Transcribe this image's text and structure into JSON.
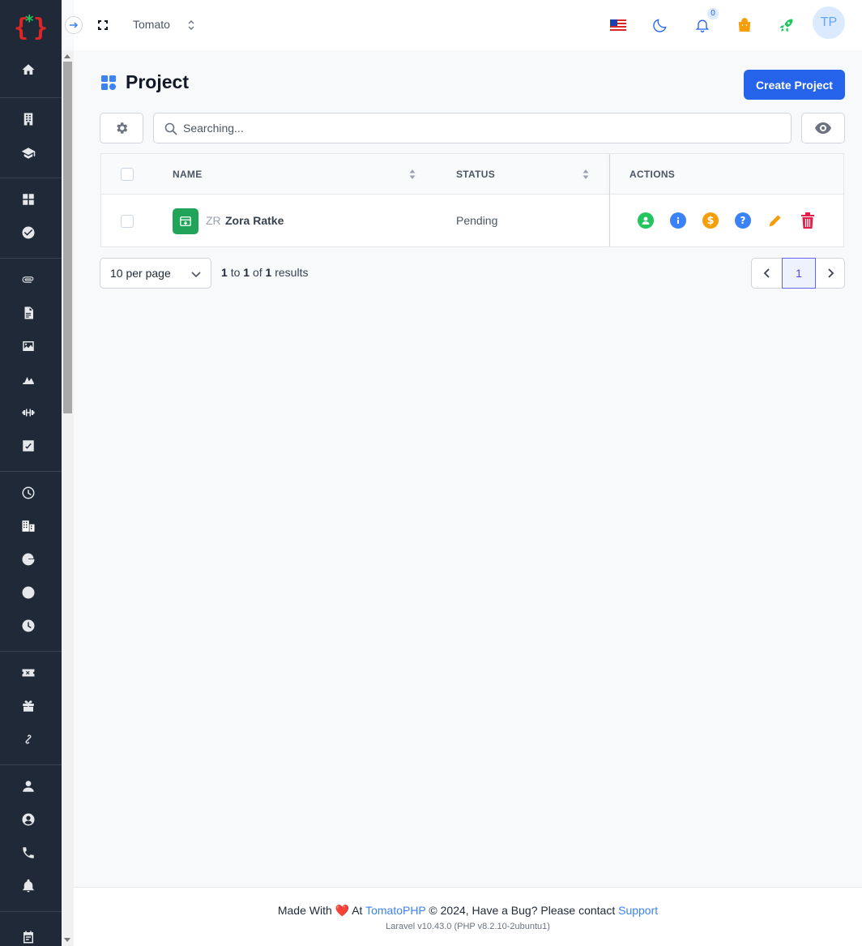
{
  "header": {
    "tenant": "Tomato",
    "notifications_count": "0",
    "avatar_initials": "TP"
  },
  "page": {
    "title": "Project",
    "create_button": "Create Project"
  },
  "search": {
    "placeholder": "Searching..."
  },
  "table": {
    "columns": [
      "NAME",
      "STATUS",
      "ACTIONS"
    ],
    "rows": [
      {
        "initials": "ZR",
        "name": "Zora Ratke",
        "status": "Pending"
      }
    ]
  },
  "pagination": {
    "per_page": "10 per page",
    "from": "1",
    "to": "1",
    "total": "1",
    "to_label": "to",
    "of_label": "of",
    "results_label": "results",
    "current_page": "1"
  },
  "footer": {
    "made_with": "Made With",
    "heart": "❤️",
    "at": "At",
    "brand": "TomatoPHP",
    "copyright": "© 2024, Have a Bug? Please contact",
    "support": "Support",
    "version": "Laravel v10.43.0 (PHP v8.2.10-2ubuntu1)"
  },
  "colors": {
    "primary": "#2563eb",
    "sidebar": "#1f2937",
    "brand_red": "#dc2626",
    "brand_green": "#22c55e",
    "status_pending_badge": "#22a35a",
    "delete": "#e11d48",
    "edit": "#f59e0b"
  },
  "icons": {
    "sidebar": [
      "home-icon",
      "building-icon",
      "school-icon",
      "grid-icon",
      "check-circle-icon",
      "paperclip-icon",
      "document-icon",
      "image-icon",
      "chart-area-icon",
      "dumbbell-icon",
      "chart-check-icon",
      "clock-icon",
      "buildings-icon",
      "pie-chart-icon",
      "bolt-icon",
      "clock-filled-icon",
      "ticket-icon",
      "gift-icon",
      "link-icon",
      "user-icon",
      "user-circle-icon",
      "phone-icon",
      "bell-icon",
      "calendar-icon"
    ],
    "row_actions": [
      "user-circle-icon",
      "info-icon",
      "dollar-icon",
      "question-icon",
      "pencil-icon",
      "trash-icon"
    ]
  }
}
